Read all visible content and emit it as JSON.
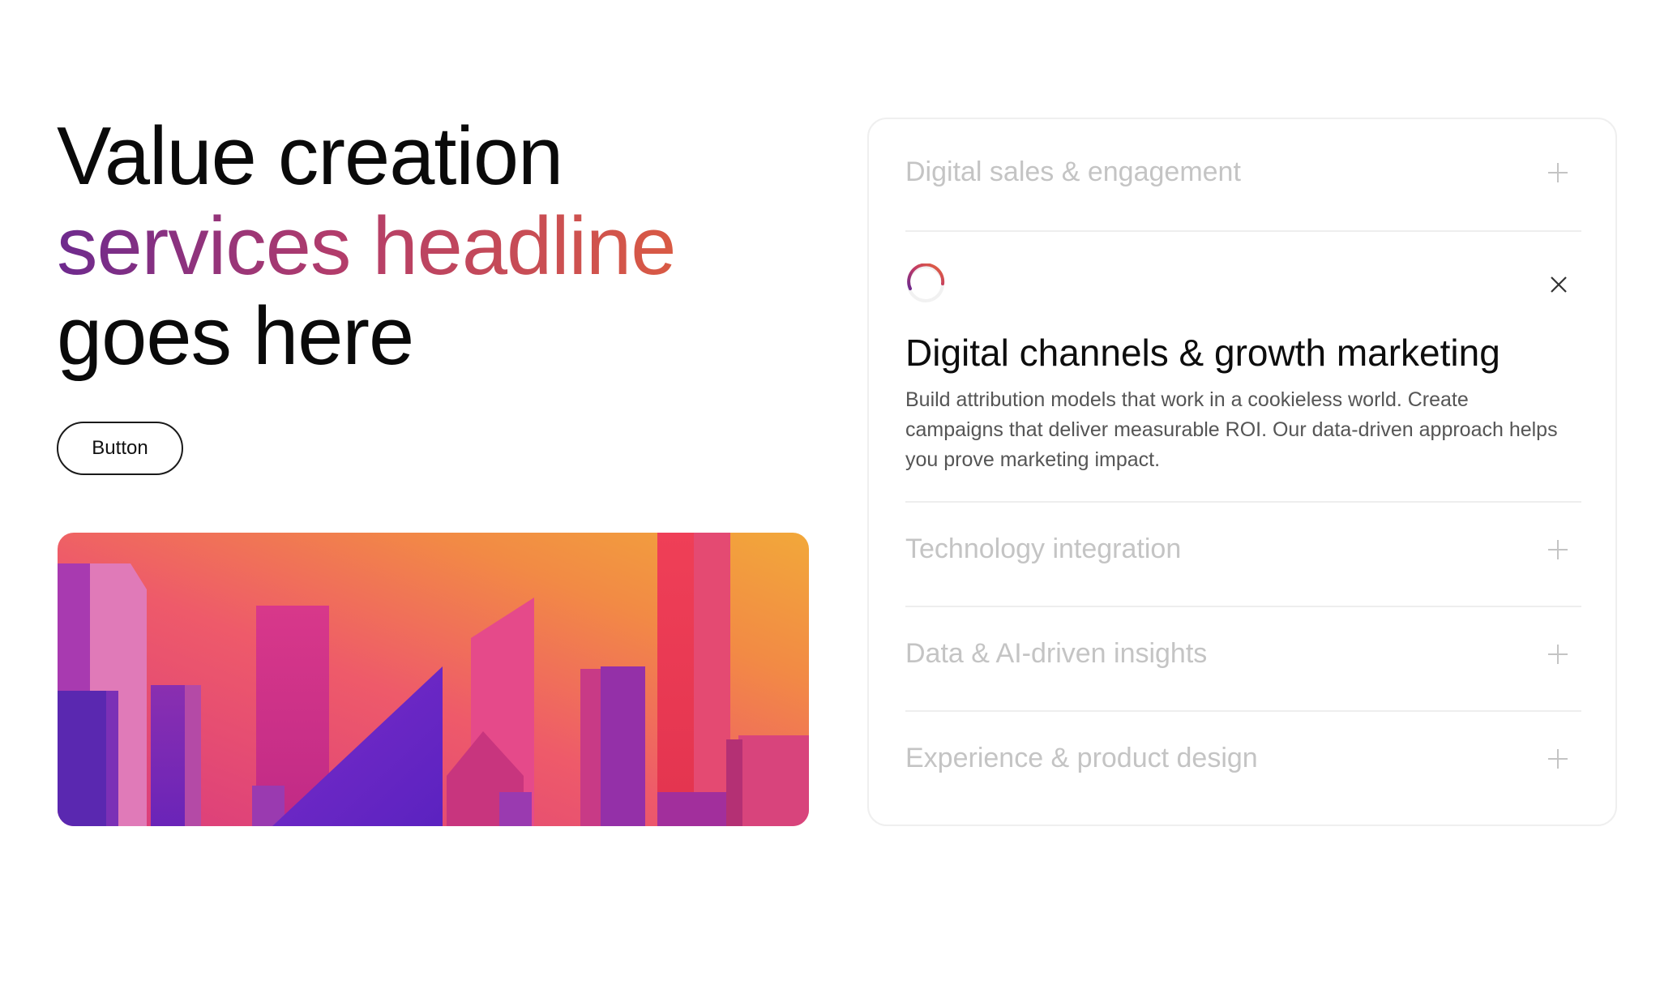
{
  "hero": {
    "headline_line1": "Value creation",
    "headline_line2": "services headline",
    "headline_line3": "goes here",
    "button_label": "Button"
  },
  "accordion": {
    "items": [
      {
        "label": "Digital sales & engagement",
        "expanded": false
      },
      {
        "label": "Digital channels & growth marketing",
        "expanded": true,
        "description": "Build attribution models that work in a cookieless world. Create campaigns that deliver measurable ROI. Our data-driven approach helps you prove marketing impact."
      },
      {
        "label": "Technology integration",
        "expanded": false
      },
      {
        "label": "Data & AI-driven insights",
        "expanded": false
      },
      {
        "label": "Experience & product design",
        "expanded": false
      }
    ]
  },
  "colors": {
    "gradient_start": "#6d2a8e",
    "gradient_mid": "#b23c6b",
    "gradient_end": "#d95a44",
    "muted_text": "#c4c4c4",
    "body_text": "#555555"
  },
  "icons": {
    "collapsed": "plus-icon",
    "expanded": "close-icon",
    "active_indicator": "spinner-icon"
  }
}
